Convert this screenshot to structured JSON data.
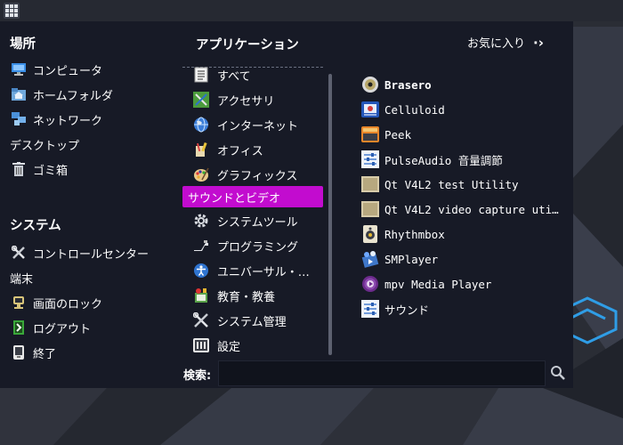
{
  "places": {
    "title": "場所",
    "items": [
      {
        "label": "コンピュータ",
        "icon": "monitor-icon"
      },
      {
        "label": "ホームフォルダ",
        "icon": "home-folder-icon"
      },
      {
        "label": "ネットワーク",
        "icon": "network-icon"
      },
      {
        "label": "デスクトップ",
        "icon": ""
      },
      {
        "label": "ゴミ箱",
        "icon": "trash-icon"
      }
    ]
  },
  "system": {
    "title": "システム",
    "items": [
      {
        "label": "コントロールセンター",
        "icon": "tools-icon"
      },
      {
        "label": "端末",
        "icon": ""
      },
      {
        "label": "画面のロック",
        "icon": "lock-screen-icon"
      },
      {
        "label": "ログアウト",
        "icon": "logout-icon"
      },
      {
        "label": "終了",
        "icon": "shutdown-icon"
      }
    ]
  },
  "applications": {
    "title": "アプリケーション",
    "favorites_label": "お気に入り",
    "categories": [
      {
        "label": "すべて",
        "icon": "all-apps-icon"
      },
      {
        "label": "アクセサリ",
        "icon": "accessories-icon"
      },
      {
        "label": "インターネット",
        "icon": "globe-icon"
      },
      {
        "label": "オフィス",
        "icon": "office-icon"
      },
      {
        "label": "グラフィックス",
        "icon": "palette-icon"
      },
      {
        "label": "サウンドとビデオ",
        "icon": "",
        "active": true
      },
      {
        "label": "システムツール",
        "icon": "gear-icon"
      },
      {
        "label": "プログラミング",
        "icon": "programming-icon"
      },
      {
        "label": "ユニバーサル・…",
        "icon": "accessibility-icon"
      },
      {
        "label": "教育・教養",
        "icon": "education-icon"
      },
      {
        "label": "システム管理",
        "icon": "admin-tools-icon"
      },
      {
        "label": "設定",
        "icon": "settings-icon"
      }
    ],
    "apps": [
      {
        "label": "Brasero",
        "icon": "brasero-disc-icon",
        "bold": true
      },
      {
        "label": "Celluloid",
        "icon": "celluloid-icon"
      },
      {
        "label": "Peek",
        "icon": "peek-icon"
      },
      {
        "label": "PulseAudio 音量調節",
        "icon": "mixer-icon"
      },
      {
        "label": "Qt V4L2 test Utility",
        "icon": "qv4l2-icon"
      },
      {
        "label": "Qt V4L2 video capture util…",
        "icon": "qvidcap-icon"
      },
      {
        "label": "Rhythmbox",
        "icon": "rhythmbox-icon"
      },
      {
        "label": "SMPlayer",
        "icon": "smplayer-icon"
      },
      {
        "label": "mpv Media Player",
        "icon": "mpv-icon"
      },
      {
        "label": "サウンド",
        "icon": "sound-settings-icon"
      }
    ]
  },
  "search": {
    "label": "検索:",
    "value": "",
    "placeholder": ""
  },
  "colors": {
    "menu_bg": "#171a26",
    "active_category": "#c20ccf",
    "desktop_bg": "#2a2d35",
    "accent": "#1e90ff"
  }
}
